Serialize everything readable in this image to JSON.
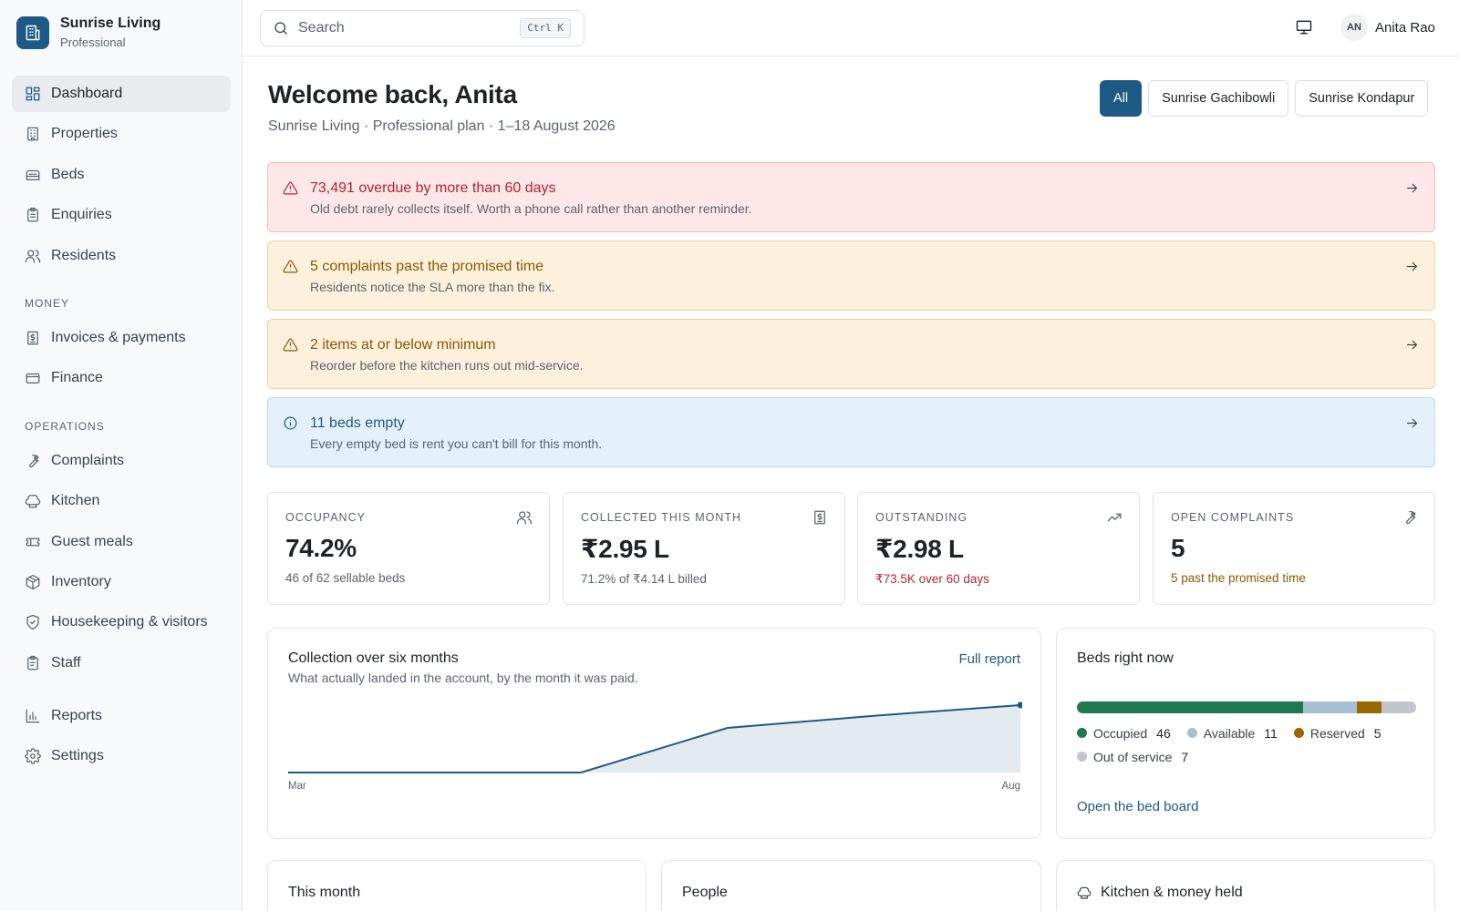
{
  "brand": {
    "name": "Sunrise Living",
    "plan": "Professional"
  },
  "sidebar": {
    "items": [
      {
        "label": "Dashboard",
        "icon": "dashboard-icon",
        "active": true
      },
      {
        "label": "Properties",
        "icon": "building-icon"
      },
      {
        "label": "Beds",
        "icon": "bed-icon"
      },
      {
        "label": "Enquiries",
        "icon": "clipboard-icon"
      },
      {
        "label": "Residents",
        "icon": "users-icon"
      }
    ],
    "money_section": "MONEY",
    "money_items": [
      {
        "label": "Invoices & payments",
        "icon": "receipt-icon"
      },
      {
        "label": "Finance",
        "icon": "credit-card-icon"
      }
    ],
    "operations_section": "OPERATIONS",
    "operations_items": [
      {
        "label": "Complaints",
        "icon": "wrench-icon"
      },
      {
        "label": "Kitchen",
        "icon": "chef-hat-icon"
      },
      {
        "label": "Guest meals",
        "icon": "ticket-icon"
      },
      {
        "label": "Inventory",
        "icon": "package-icon"
      },
      {
        "label": "Housekeeping & visitors",
        "icon": "shield-icon"
      },
      {
        "label": "Staff",
        "icon": "clipboard-list-icon"
      }
    ],
    "footer_items": [
      {
        "label": "Reports",
        "icon": "bar-chart-icon"
      },
      {
        "label": "Settings",
        "icon": "gear-icon"
      }
    ]
  },
  "topbar": {
    "search_placeholder": "Search",
    "search_shortcut": "Ctrl K",
    "user_initials": "AN",
    "user_name": "Anita Rao"
  },
  "header": {
    "title": "Welcome back, Anita",
    "subtitle": "Sunrise Living · Professional plan · 1–18 August 2026",
    "filters": [
      {
        "label": "All",
        "active": true
      },
      {
        "label": "Sunrise Gachibowli"
      },
      {
        "label": "Sunrise Kondapur"
      }
    ]
  },
  "alerts": [
    {
      "level": "danger",
      "title": "73,491 overdue by more than 60 days",
      "body": "Old debt rarely collects itself. Worth a phone call rather than another reminder."
    },
    {
      "level": "warn",
      "title": "5 complaints past the promised time",
      "body": "Residents notice the SLA more than the fix."
    },
    {
      "level": "warn",
      "title": "2 items at or below minimum",
      "body": "Reorder before the kitchen runs out mid-service."
    },
    {
      "level": "info",
      "title": "11 beds empty",
      "body": "Every empty bed is rent you can't bill for this month."
    }
  ],
  "kpis": [
    {
      "label": "OCCUPANCY",
      "value": "74.2%",
      "sub": "46 of 62 sellable beds",
      "icon": "users-icon"
    },
    {
      "label": "COLLECTED THIS MONTH",
      "value": "₹2.95 L",
      "sub": "71.2% of ₹4.14 L billed",
      "icon": "receipt-icon"
    },
    {
      "label": "OUTSTANDING",
      "value": "₹2.98 L",
      "sub": "₹73.5K over 60 days",
      "icon": "trending-up-icon"
    },
    {
      "label": "OPEN COMPLAINTS",
      "value": "5",
      "sub": "5 past the promised time",
      "icon": "wrench-icon"
    }
  ],
  "collection": {
    "title": "Collection over six months",
    "subtitle": "What actually landed in the account, by the month it was paid.",
    "link": "Full report"
  },
  "chart_data": {
    "type": "area",
    "title": "Collection over six months",
    "x_labels_shown": [
      "Mar",
      "Aug"
    ],
    "x": [
      "Mar",
      "Apr",
      "May",
      "Jun",
      "Jul",
      "Aug"
    ],
    "series": [
      {
        "values": [
          0,
          0,
          0,
          1.0,
          1.27,
          1.51
        ]
      }
    ],
    "ylim": [
      0,
      1.55
    ],
    "grid": false,
    "colors": {
      "line": "#1e5a86",
      "fill": "#e3eaf0"
    }
  },
  "beds": {
    "title": "Beds right now",
    "segments": [
      {
        "label": "Occupied",
        "count": "46",
        "value": 46,
        "color": "#1d7a4f"
      },
      {
        "label": "Available",
        "count": "11",
        "value": 11,
        "color": "#a7bfd3"
      },
      {
        "label": "Reserved",
        "count": "5",
        "value": 5,
        "color": "#9a6700"
      },
      {
        "label": "Out of service",
        "count": "7",
        "value": 7,
        "color": "#c2c6cc"
      }
    ],
    "link": "Open the bed board"
  },
  "bottom_panels": {
    "this_month": "This month",
    "people": "People",
    "kitchen_money": "Kitchen & money held"
  }
}
